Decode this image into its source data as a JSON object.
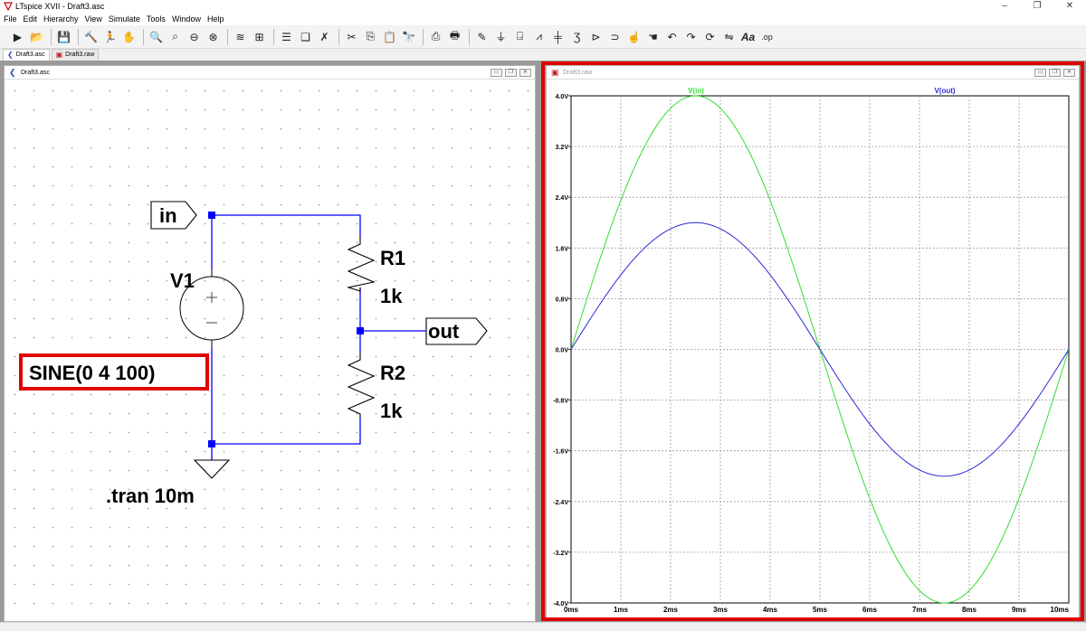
{
  "window": {
    "title": "LTspice XVII - Draft3.asc",
    "min": "–",
    "restore": "❐",
    "close": "✕"
  },
  "menu": [
    "File",
    "Edit",
    "Hierarchy",
    "View",
    "Simulate",
    "Tools",
    "Window",
    "Help"
  ],
  "toolbar_icons": [
    "run-icon",
    "open-icon",
    "save-icon",
    "control-panel-icon",
    "halt-icon",
    "pan-icon",
    "zoom-in-icon",
    "zoom-area-icon",
    "zoom-out-icon",
    "zoom-fit-icon",
    "autorange-icon",
    "grid-icon",
    "tile-horizontal-icon",
    "cascade-icon",
    "close-all-icon",
    "cut-icon",
    "copy-icon",
    "paste-icon",
    "find-icon",
    "print-setup-icon",
    "print-icon",
    "draw-wire-icon",
    "ground-icon",
    "label-net-icon",
    "resistor-icon",
    "capacitor-icon",
    "inductor-icon",
    "diode-icon",
    "component-icon",
    "move-icon",
    "drag-icon",
    "undo-icon",
    "redo-icon",
    "rotate-icon",
    "mirror-icon",
    "text-icon",
    "spice-directive-icon"
  ],
  "tabs": [
    "Draft3.asc",
    "Draft3.raw"
  ],
  "schematic": {
    "window_title": "Draft3.asc",
    "labels": {
      "in": "in",
      "out": "out",
      "v1": "V1",
      "r1": "R1",
      "r1_value": "1k",
      "r2": "R2",
      "r2_value": "1k",
      "source_value": "SINE(0 4 100)",
      "directive": ".tran 10m"
    }
  },
  "waveform": {
    "window_title": "Draft3.raw"
  },
  "chart_data": {
    "type": "line",
    "x_unit": "ms",
    "xlim": [
      0,
      10
    ],
    "ylim": [
      -4.0,
      4.0
    ],
    "yticks": [
      "4.0V",
      "3.2V",
      "2.4V",
      "1.6V",
      "0.8V",
      "0.0V",
      "-0.8V",
      "-1.6V",
      "-2.4V",
      "-3.2V",
      "-4.0V"
    ],
    "xticks": [
      "0ms",
      "1ms",
      "2ms",
      "3ms",
      "4ms",
      "5ms",
      "6ms",
      "7ms",
      "8ms",
      "9ms",
      "10ms"
    ],
    "grid": true,
    "series": [
      {
        "name": "V(in)",
        "color": "#33dd33",
        "amplitude": 4,
        "frequency_hz": 100,
        "x": [
          0,
          0.5,
          1,
          1.5,
          2,
          2.5,
          3,
          3.5,
          4,
          4.5,
          5,
          5.5,
          6,
          6.5,
          7,
          7.5,
          8,
          8.5,
          9,
          9.5,
          10
        ],
        "y": [
          0,
          1.24,
          2.35,
          3.24,
          3.8,
          4.0,
          3.8,
          3.24,
          2.35,
          1.24,
          0,
          -1.24,
          -2.35,
          -3.24,
          -3.8,
          -4.0,
          -3.8,
          -3.24,
          -2.35,
          -1.24,
          0
        ]
      },
      {
        "name": "V(out)",
        "color": "#2b2bd9",
        "amplitude": 2,
        "frequency_hz": 100,
        "x": [
          0,
          0.5,
          1,
          1.5,
          2,
          2.5,
          3,
          3.5,
          4,
          4.5,
          5,
          5.5,
          6,
          6.5,
          7,
          7.5,
          8,
          8.5,
          9,
          9.5,
          10
        ],
        "y": [
          0,
          0.62,
          1.18,
          1.62,
          1.9,
          2.0,
          1.9,
          1.62,
          1.18,
          0.62,
          0,
          -0.62,
          -1.18,
          -1.62,
          -1.9,
          -2.0,
          -1.9,
          -1.62,
          -1.18,
          -0.62,
          0
        ]
      }
    ]
  },
  "colors": {
    "wire": "#0000ff",
    "highlight": "#e00000",
    "grid": "#a0a0a0"
  }
}
